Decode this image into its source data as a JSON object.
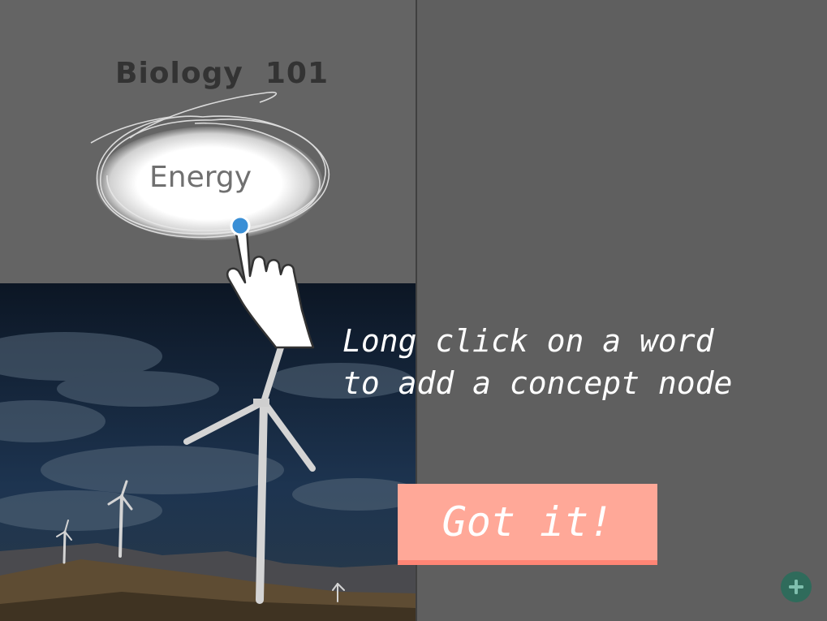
{
  "document": {
    "title": "Biology  101"
  },
  "highlight": {
    "word": "Energy"
  },
  "tutorial": {
    "line1": "Long click on a word",
    "line2": "to add a concept node",
    "dismiss_label": "Got it!"
  },
  "colors": {
    "overlay": "#5f5f5f",
    "button": "#ffa898",
    "button_shadow": "#ff8575",
    "fab": "#2f6b5b",
    "touch_dot": "#3a8fd6"
  },
  "icons": {
    "hand": "pointing-hand-icon",
    "add": "plus-icon"
  }
}
